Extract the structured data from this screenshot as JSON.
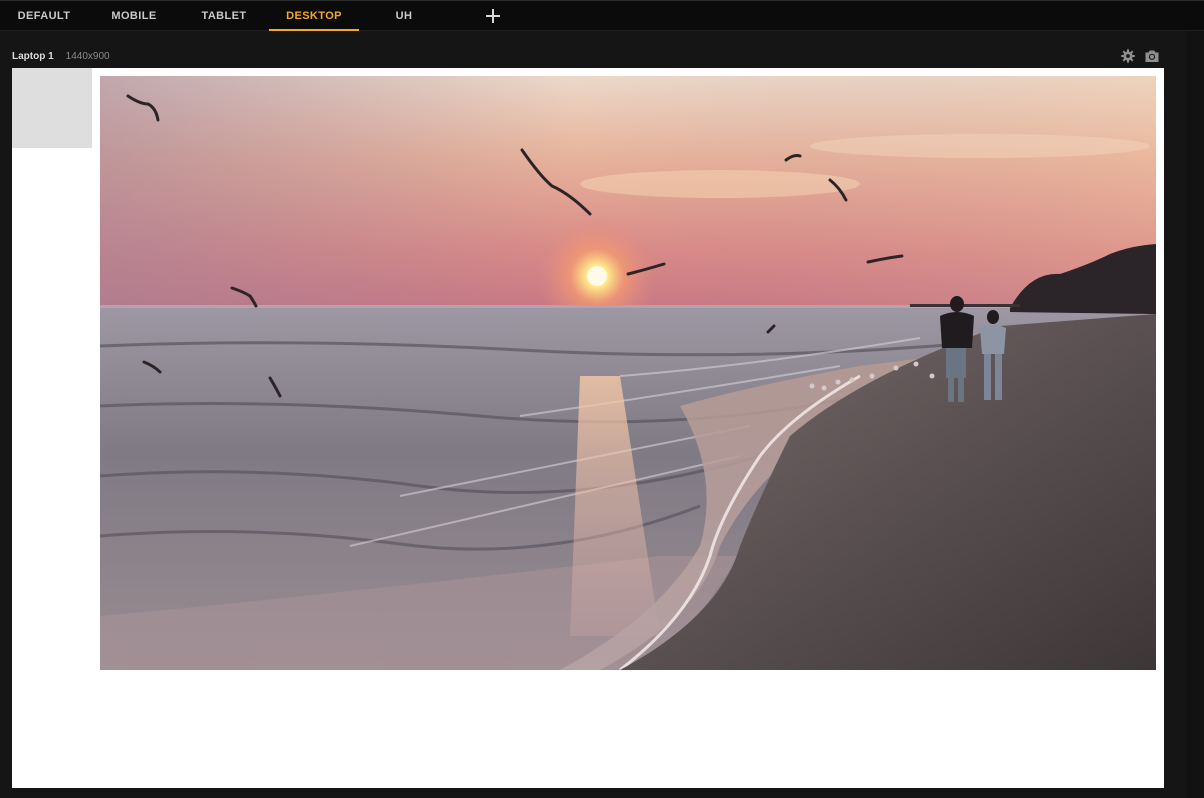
{
  "tabs": [
    {
      "label": "DEFAULT",
      "active": false
    },
    {
      "label": "MOBILE",
      "active": false
    },
    {
      "label": "TABLET",
      "active": false
    },
    {
      "label": "DESKTOP",
      "active": true
    },
    {
      "label": "UH",
      "active": false
    }
  ],
  "add_tab_icon": "plus-icon",
  "device": {
    "name": "Laptop 1",
    "resolution": "1440x900"
  },
  "toolbar_icons": [
    "gear-icon",
    "camera-icon"
  ],
  "colors": {
    "accent": "#f3a929",
    "topbar_bg": "#0b0b0b",
    "workspace_bg": "#151515",
    "canvas_bg": "#ffffff",
    "placeholder_bg": "#dedede"
  }
}
